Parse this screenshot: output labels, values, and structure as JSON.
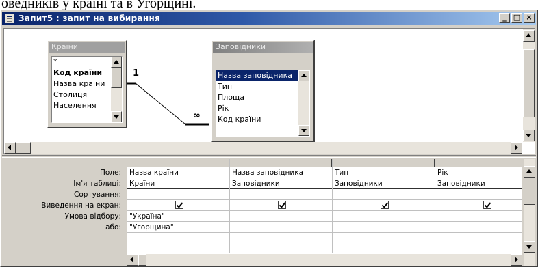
{
  "caption": "оведників у країні та в Угорщині.",
  "window": {
    "title": "Запит5 : запит на вибирання",
    "minimize_label": "_",
    "maximize_label": "□",
    "close_label": "×"
  },
  "tables": {
    "countries": {
      "title": "Країни",
      "fields": [
        "*",
        "Код країни",
        "Назва країни",
        "Столиця",
        "Населення"
      ]
    },
    "reserves": {
      "title": "Заповідники",
      "fields": [
        "Назва заповідника",
        "Тип",
        "Площа",
        "Рік",
        "Код країни"
      ]
    }
  },
  "join": {
    "one_label": "1",
    "many_label": "∞"
  },
  "grid": {
    "row_labels": [
      "Поле:",
      "Ім'я таблиці:",
      "Сортування:",
      "Виведення на екран:",
      "Умова відбору:",
      "або:"
    ],
    "columns": [
      {
        "field": "Назва країни",
        "table": "Країни",
        "sort": "",
        "show": true,
        "criteria": "\"Україна\"",
        "or": "\"Угорщина\""
      },
      {
        "field": "Назва заповідника",
        "table": "Заповідники",
        "sort": "",
        "show": true,
        "criteria": "",
        "or": ""
      },
      {
        "field": "Тип",
        "table": "Заповідники",
        "sort": "",
        "show": true,
        "criteria": "",
        "or": ""
      },
      {
        "field": "Рік",
        "table": "Заповідники",
        "sort": "",
        "show": true,
        "criteria": "",
        "or": ""
      }
    ]
  }
}
